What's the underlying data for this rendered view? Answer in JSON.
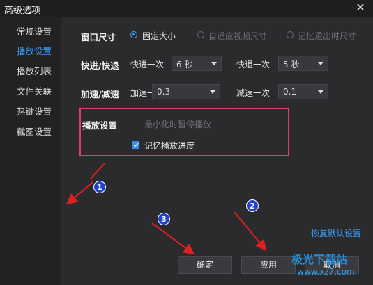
{
  "window": {
    "title": "高级选项",
    "close_symbol": "✕"
  },
  "sidebar": {
    "items": [
      {
        "label": "常规设置",
        "active": false
      },
      {
        "label": "播放设置",
        "active": true
      },
      {
        "label": "播放列表",
        "active": false
      },
      {
        "label": "文件关联",
        "active": false
      },
      {
        "label": "热键设置",
        "active": false
      },
      {
        "label": "截图设置",
        "active": false
      }
    ]
  },
  "window_size": {
    "label": "窗口尺寸",
    "options": [
      {
        "label": "固定大小",
        "selected": true,
        "enabled": true
      },
      {
        "label": "自适应视频尺寸",
        "selected": false,
        "enabled": false
      },
      {
        "label": "记忆退出时尺寸",
        "selected": false,
        "enabled": false
      }
    ]
  },
  "seek": {
    "label": "快进/快退",
    "forward_label": "快进一次",
    "forward_value": "6 秒",
    "backward_label": "快退一次",
    "backward_value": "5 秒"
  },
  "speed": {
    "label": "加速/减速",
    "up_label": "加速一次",
    "up_value": "0.3",
    "down_label": "减速一次",
    "down_value": "0.1"
  },
  "playback": {
    "label": "播放设置",
    "pause_on_minimize": {
      "label": "最小化时暂停播放",
      "checked": false,
      "enabled": false
    },
    "remember_progress": {
      "label": "记忆播放进度",
      "checked": true,
      "enabled": true
    }
  },
  "buttons": {
    "restore_defaults": "恢复默认设置",
    "ok": "确定",
    "apply": "应用",
    "cancel": "取消"
  },
  "annotations": {
    "badge1": "1",
    "badge2": "2",
    "badge3": "3"
  },
  "watermark": {
    "text": "极光下载站",
    "url": "www.xz7.com"
  },
  "colors": {
    "accent": "#3aa0ff",
    "highlight": "#e53a6a",
    "arrow": "#e02020",
    "badge": "#2244cc"
  }
}
